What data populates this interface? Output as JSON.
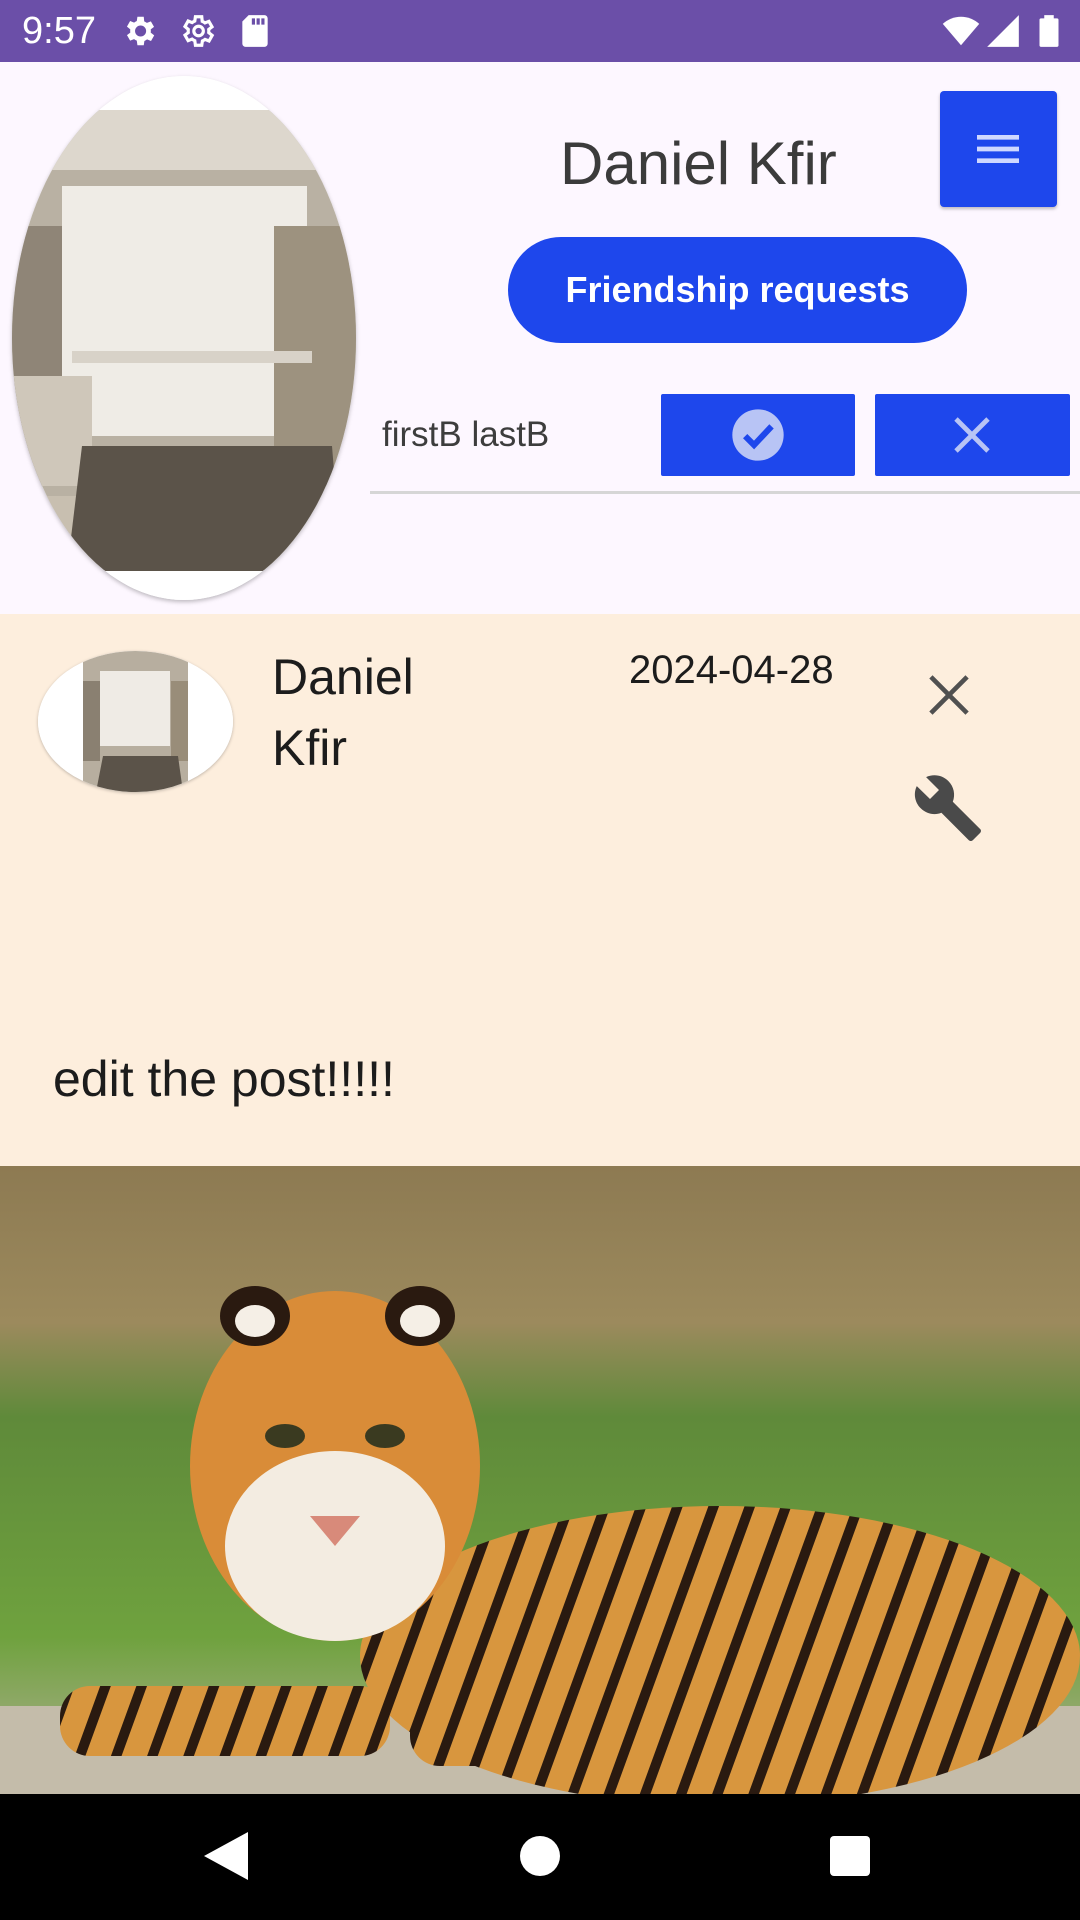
{
  "status_bar": {
    "time": "9:57",
    "left_icons": [
      "settings-gear-icon",
      "settings-gear-outline-icon",
      "sd-card-icon"
    ],
    "right_icons": [
      "wifi-icon",
      "cell-signal-icon",
      "battery-icon"
    ],
    "background": "#6b4fa8"
  },
  "profile": {
    "name": "Daniel Kfir",
    "menu_icon": "hamburger-menu-icon",
    "friendship_requests_label": "Friendship requests",
    "accent": "#1e47ec"
  },
  "friend_requests": [
    {
      "name": "firstB lastB",
      "accept_icon": "check-circle-icon",
      "decline_icon": "close-icon"
    }
  ],
  "post": {
    "author": "Daniel Kfir",
    "date": "2024-04-28",
    "text": "edit the post!!!!!",
    "delete_icon": "close-icon",
    "edit_icon": "wrench-icon",
    "image": "tiger-photo",
    "background": "#fdeedd"
  },
  "nav_bar": {
    "icons": [
      "back-icon",
      "home-icon",
      "recents-icon"
    ]
  }
}
